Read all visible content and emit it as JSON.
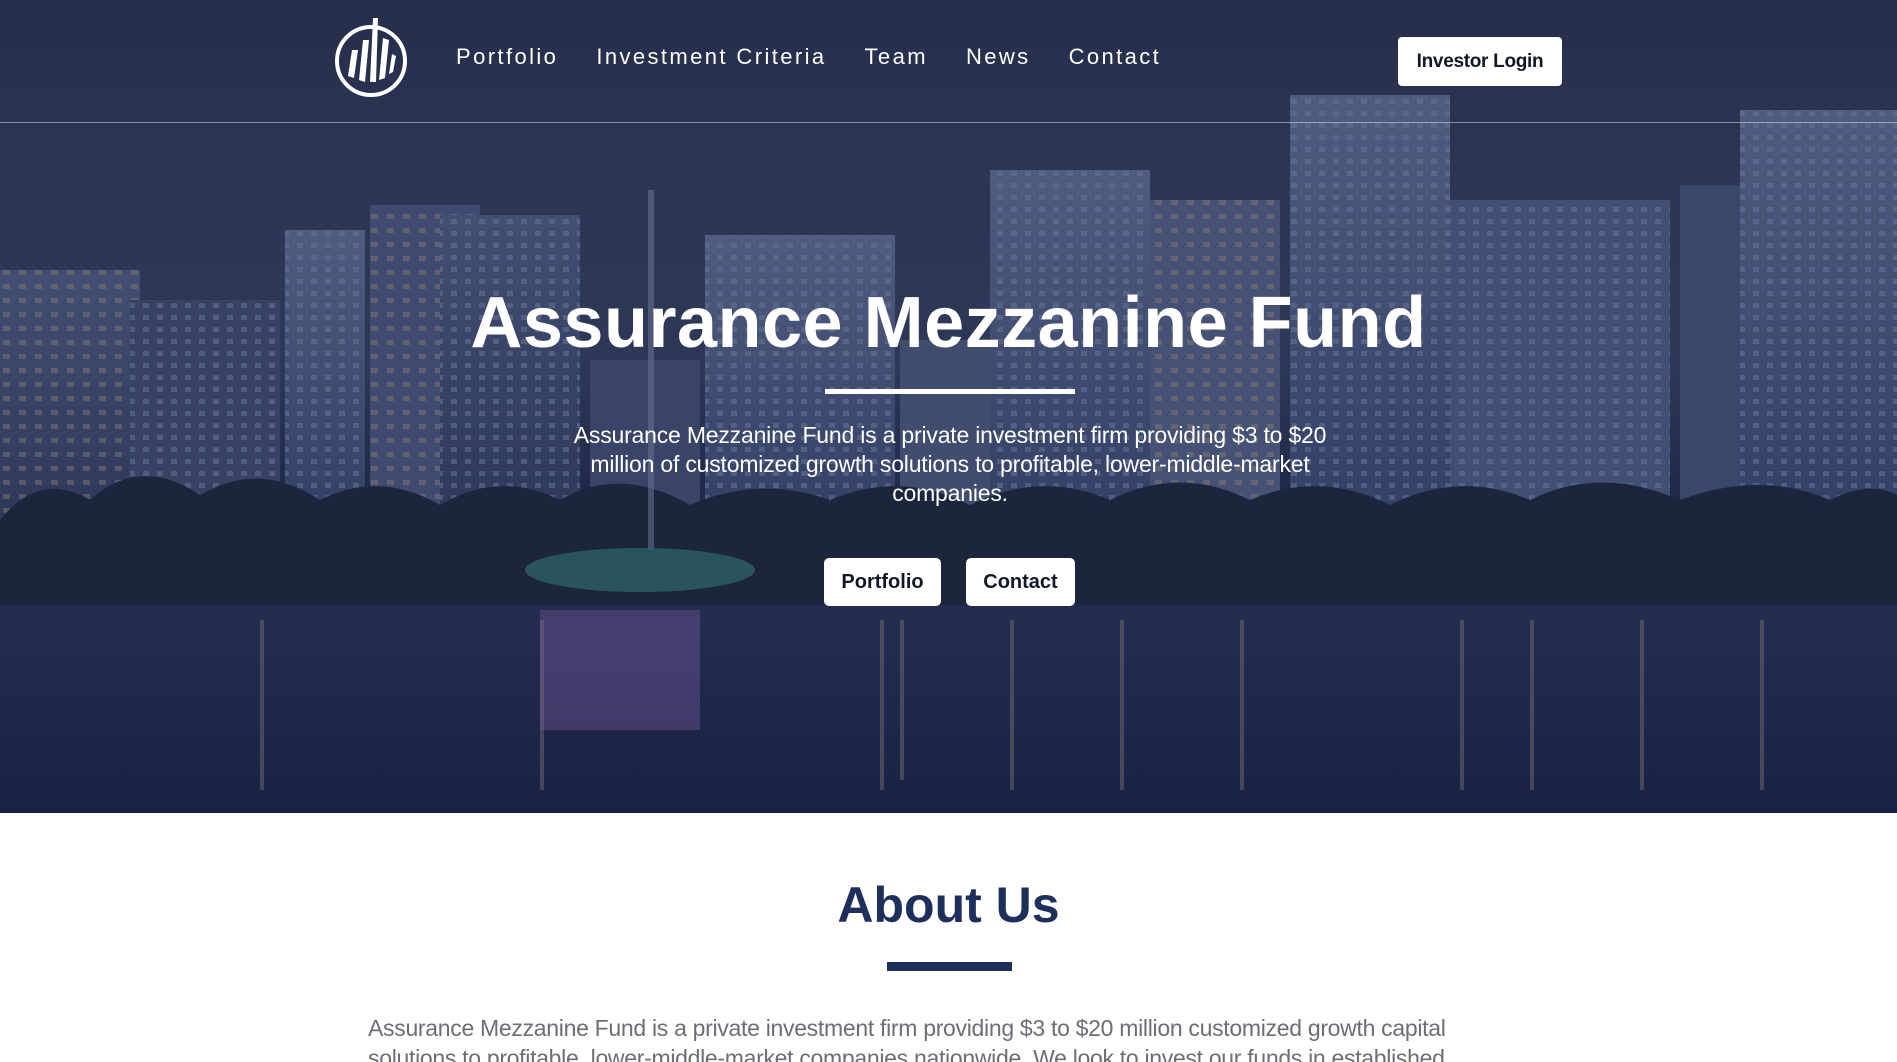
{
  "nav": {
    "links": [
      "Portfolio",
      "Investment Criteria",
      "Team",
      "News",
      "Contact"
    ],
    "login_label": "Investor Login"
  },
  "hero": {
    "title": "Assurance Mezzanine Fund",
    "subtitle": "Assurance Mezzanine Fund is a private investment firm providing $3 to $20 million of customized growth solutions to profitable, lower-middle-market companies.",
    "buttons": {
      "portfolio": "Portfolio",
      "contact": "Contact"
    }
  },
  "about": {
    "title": "About Us",
    "text": "Assurance Mezzanine Fund is a private investment firm providing $3 to $20 million customized growth capital solutions to profitable, lower-middle-market companies nationwide. We look to invest our funds in established"
  },
  "colors": {
    "accent": "#1f2f5c",
    "button_bg": "#ffffff",
    "button_text": "#101826",
    "body_text": "#6b6e75"
  },
  "icons": {
    "logo": "building-logo-icon"
  }
}
